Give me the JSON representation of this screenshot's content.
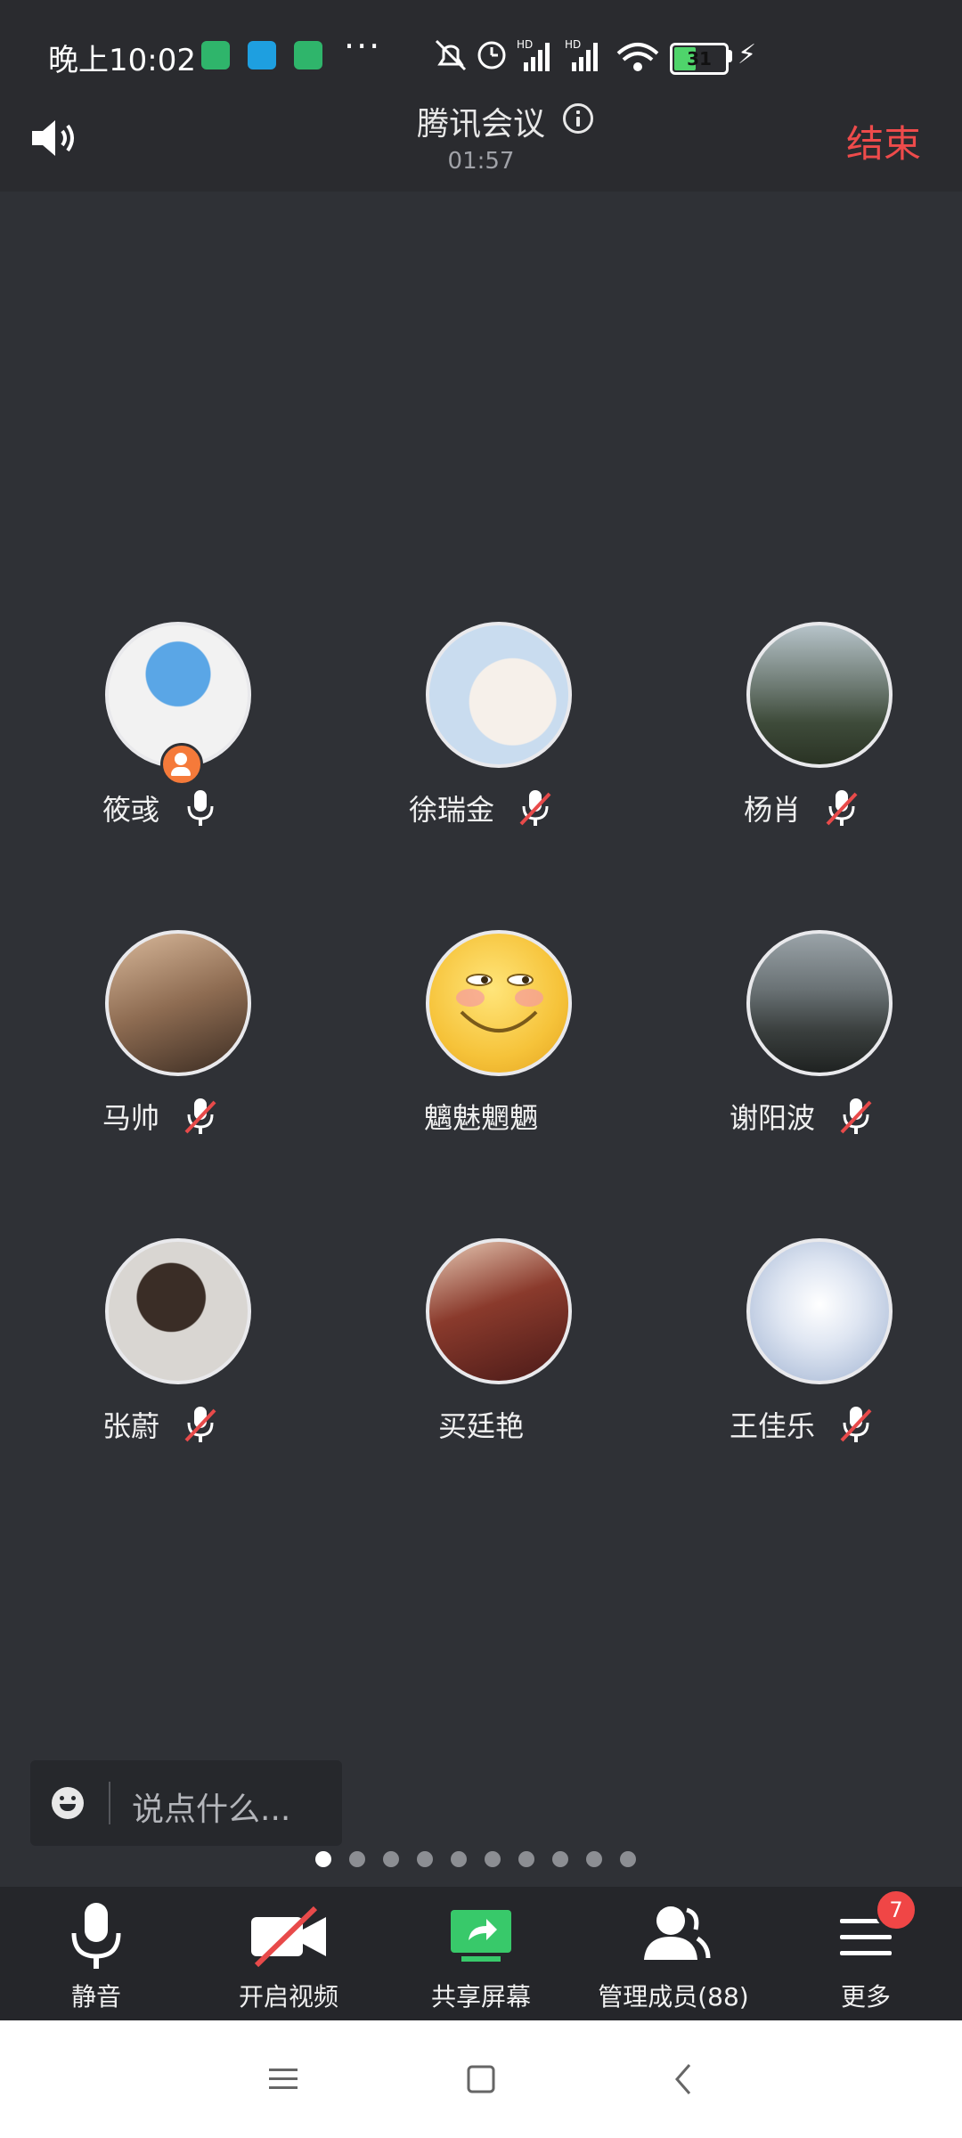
{
  "status_bar": {
    "time": "晚上10:02",
    "battery": "31"
  },
  "header": {
    "title": "腾讯会议",
    "duration": "01:57",
    "end_label": "结束"
  },
  "participants": [
    {
      "name": "筱彧",
      "muted": false,
      "host": true
    },
    {
      "name": "徐瑞金",
      "muted": true,
      "host": false
    },
    {
      "name": "杨肖",
      "muted": true,
      "host": false
    },
    {
      "name": "马帅",
      "muted": true,
      "host": false
    },
    {
      "name": "魑魅魍魉",
      "muted": null,
      "host": false
    },
    {
      "name": "谢阳波",
      "muted": true,
      "host": false
    },
    {
      "name": "张蔚",
      "muted": true,
      "host": false
    },
    {
      "name": "买廷艳",
      "muted": null,
      "host": false
    },
    {
      "name": "王佳乐",
      "muted": true,
      "host": false
    }
  ],
  "chat": {
    "placeholder": "说点什么..."
  },
  "pagination": {
    "pages": 10,
    "current": 1
  },
  "toolbar": {
    "mute_label": "静音",
    "video_label": "开启视频",
    "share_label": "共享屏幕",
    "members_label": "管理成员(88)",
    "more_label": "更多",
    "more_badge": "7"
  },
  "colors": {
    "background": "#2f3136",
    "end_red": "#ee4b4b",
    "share_green": "#38c96a",
    "badge_red": "#f04646",
    "host_orange": "#f57a3a"
  }
}
